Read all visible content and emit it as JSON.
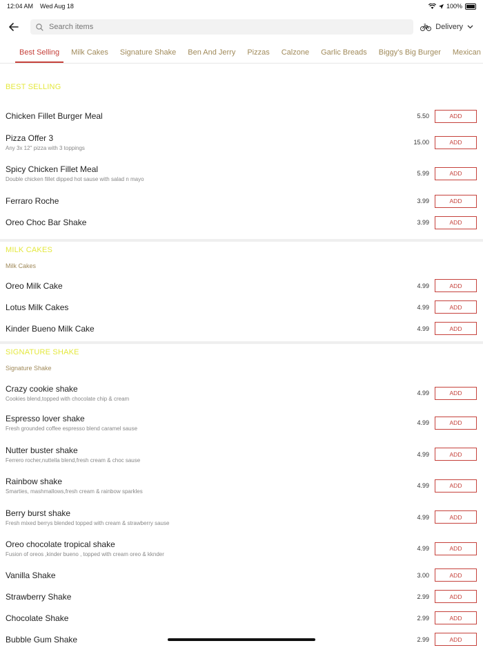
{
  "status": {
    "time": "12:04 AM",
    "date": "Wed Aug 18",
    "battery": "100%"
  },
  "search": {
    "placeholder": "Search items"
  },
  "delivery": {
    "label": "Delivery"
  },
  "tabs": [
    "Best Selling",
    "Milk Cakes",
    "Signature Shake",
    "Ben And Jerry",
    "Pizzas",
    "Calzone",
    "Garlic Breads",
    "Biggy's Big Burger",
    "Mexican Main"
  ],
  "add_label": "ADD",
  "sections": {
    "best": {
      "title": "BEST SELLING",
      "items": [
        {
          "name": "Chicken Fillet Burger Meal",
          "desc": "",
          "price": "5.50"
        },
        {
          "name": "Pizza Offer 3",
          "desc": "Any 3x 12\" pizza with 3 toppings",
          "price": "15.00"
        },
        {
          "name": "Spicy Chicken Fillet Meal",
          "desc": "Double chicken fillet dipped hot sause with salad n mayo",
          "price": "5.99"
        },
        {
          "name": "Ferraro Roche",
          "desc": "",
          "price": "3.99"
        },
        {
          "name": "Oreo Choc Bar Shake",
          "desc": "",
          "price": "3.99"
        }
      ]
    },
    "milk": {
      "title": "MILK CAKES",
      "sub": "Milk Cakes",
      "items": [
        {
          "name": "Oreo Milk Cake",
          "price": "4.99"
        },
        {
          "name": "Lotus Milk Cakes",
          "price": "4.99"
        },
        {
          "name": "Kinder Bueno Milk Cake",
          "price": "4.99"
        }
      ]
    },
    "shake": {
      "title": "SIGNATURE SHAKE",
      "sub": "Signature Shake",
      "items": [
        {
          "name": "Crazy cookie shake",
          "desc": "Cookies blend,topped with chocolate chip & cream",
          "price": "4.99"
        },
        {
          "name": "Espresso lover shake",
          "desc": "Fresh grounded coffee espresso blend caramel sause",
          "price": "4.99"
        },
        {
          "name": "Nutter buster shake",
          "desc": "Ferrero rocher,nuttella blend,fresh cream & choc sause",
          "price": "4.99"
        },
        {
          "name": "Rainbow shake",
          "desc": "Smarties, mashmallows,fresh cream & rainbow sparkles",
          "price": "4.99"
        },
        {
          "name": "Berry burst shake",
          "desc": "Fresh mixed berrys blended topped with cream & strawberry sause",
          "price": "4.99"
        },
        {
          "name": "Oreo chocolate tropical shake",
          "desc": "Fusion of oreos ,kinder bueno , topped with cream oreo & kknder",
          "price": "4.99"
        },
        {
          "name": "Vanilla Shake",
          "desc": "",
          "price": "3.00"
        },
        {
          "name": "Strawberry Shake",
          "desc": "",
          "price": "2.99"
        },
        {
          "name": "Chocolate Shake",
          "desc": "",
          "price": "2.99"
        },
        {
          "name": "Bubble Gum Shake",
          "desc": "",
          "price": "2.99"
        }
      ]
    }
  }
}
